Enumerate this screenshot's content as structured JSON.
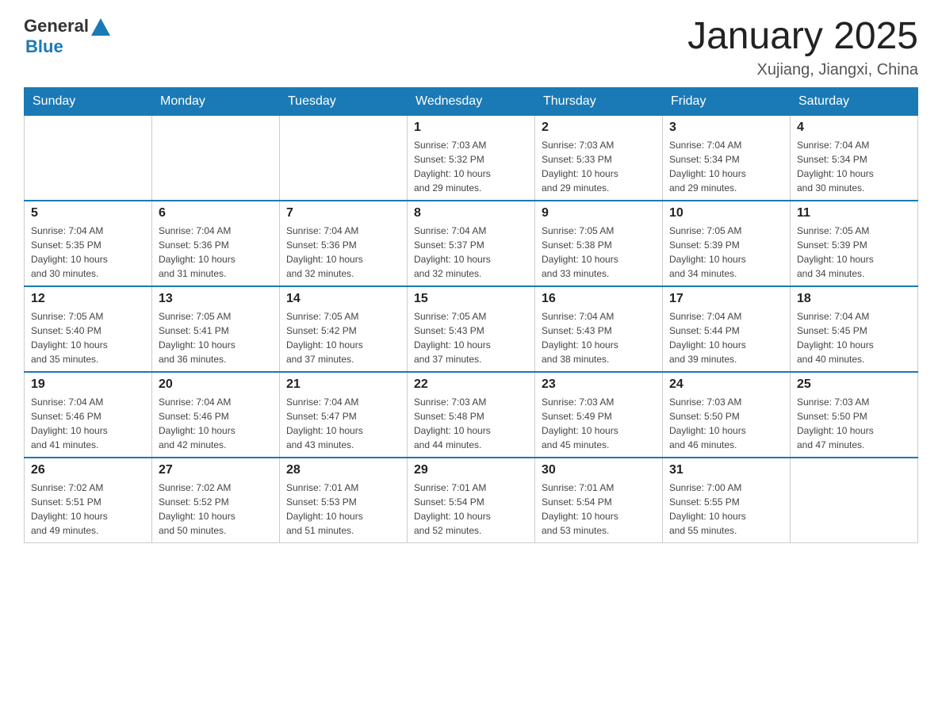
{
  "logo": {
    "general": "General",
    "blue": "Blue"
  },
  "title": "January 2025",
  "subtitle": "Xujiang, Jiangxi, China",
  "days": [
    "Sunday",
    "Monday",
    "Tuesday",
    "Wednesday",
    "Thursday",
    "Friday",
    "Saturday"
  ],
  "weeks": [
    [
      {
        "day": "",
        "info": ""
      },
      {
        "day": "",
        "info": ""
      },
      {
        "day": "",
        "info": ""
      },
      {
        "day": "1",
        "info": "Sunrise: 7:03 AM\nSunset: 5:32 PM\nDaylight: 10 hours\nand 29 minutes."
      },
      {
        "day": "2",
        "info": "Sunrise: 7:03 AM\nSunset: 5:33 PM\nDaylight: 10 hours\nand 29 minutes."
      },
      {
        "day": "3",
        "info": "Sunrise: 7:04 AM\nSunset: 5:34 PM\nDaylight: 10 hours\nand 29 minutes."
      },
      {
        "day": "4",
        "info": "Sunrise: 7:04 AM\nSunset: 5:34 PM\nDaylight: 10 hours\nand 30 minutes."
      }
    ],
    [
      {
        "day": "5",
        "info": "Sunrise: 7:04 AM\nSunset: 5:35 PM\nDaylight: 10 hours\nand 30 minutes."
      },
      {
        "day": "6",
        "info": "Sunrise: 7:04 AM\nSunset: 5:36 PM\nDaylight: 10 hours\nand 31 minutes."
      },
      {
        "day": "7",
        "info": "Sunrise: 7:04 AM\nSunset: 5:36 PM\nDaylight: 10 hours\nand 32 minutes."
      },
      {
        "day": "8",
        "info": "Sunrise: 7:04 AM\nSunset: 5:37 PM\nDaylight: 10 hours\nand 32 minutes."
      },
      {
        "day": "9",
        "info": "Sunrise: 7:05 AM\nSunset: 5:38 PM\nDaylight: 10 hours\nand 33 minutes."
      },
      {
        "day": "10",
        "info": "Sunrise: 7:05 AM\nSunset: 5:39 PM\nDaylight: 10 hours\nand 34 minutes."
      },
      {
        "day": "11",
        "info": "Sunrise: 7:05 AM\nSunset: 5:39 PM\nDaylight: 10 hours\nand 34 minutes."
      }
    ],
    [
      {
        "day": "12",
        "info": "Sunrise: 7:05 AM\nSunset: 5:40 PM\nDaylight: 10 hours\nand 35 minutes."
      },
      {
        "day": "13",
        "info": "Sunrise: 7:05 AM\nSunset: 5:41 PM\nDaylight: 10 hours\nand 36 minutes."
      },
      {
        "day": "14",
        "info": "Sunrise: 7:05 AM\nSunset: 5:42 PM\nDaylight: 10 hours\nand 37 minutes."
      },
      {
        "day": "15",
        "info": "Sunrise: 7:05 AM\nSunset: 5:43 PM\nDaylight: 10 hours\nand 37 minutes."
      },
      {
        "day": "16",
        "info": "Sunrise: 7:04 AM\nSunset: 5:43 PM\nDaylight: 10 hours\nand 38 minutes."
      },
      {
        "day": "17",
        "info": "Sunrise: 7:04 AM\nSunset: 5:44 PM\nDaylight: 10 hours\nand 39 minutes."
      },
      {
        "day": "18",
        "info": "Sunrise: 7:04 AM\nSunset: 5:45 PM\nDaylight: 10 hours\nand 40 minutes."
      }
    ],
    [
      {
        "day": "19",
        "info": "Sunrise: 7:04 AM\nSunset: 5:46 PM\nDaylight: 10 hours\nand 41 minutes."
      },
      {
        "day": "20",
        "info": "Sunrise: 7:04 AM\nSunset: 5:46 PM\nDaylight: 10 hours\nand 42 minutes."
      },
      {
        "day": "21",
        "info": "Sunrise: 7:04 AM\nSunset: 5:47 PM\nDaylight: 10 hours\nand 43 minutes."
      },
      {
        "day": "22",
        "info": "Sunrise: 7:03 AM\nSunset: 5:48 PM\nDaylight: 10 hours\nand 44 minutes."
      },
      {
        "day": "23",
        "info": "Sunrise: 7:03 AM\nSunset: 5:49 PM\nDaylight: 10 hours\nand 45 minutes."
      },
      {
        "day": "24",
        "info": "Sunrise: 7:03 AM\nSunset: 5:50 PM\nDaylight: 10 hours\nand 46 minutes."
      },
      {
        "day": "25",
        "info": "Sunrise: 7:03 AM\nSunset: 5:50 PM\nDaylight: 10 hours\nand 47 minutes."
      }
    ],
    [
      {
        "day": "26",
        "info": "Sunrise: 7:02 AM\nSunset: 5:51 PM\nDaylight: 10 hours\nand 49 minutes."
      },
      {
        "day": "27",
        "info": "Sunrise: 7:02 AM\nSunset: 5:52 PM\nDaylight: 10 hours\nand 50 minutes."
      },
      {
        "day": "28",
        "info": "Sunrise: 7:01 AM\nSunset: 5:53 PM\nDaylight: 10 hours\nand 51 minutes."
      },
      {
        "day": "29",
        "info": "Sunrise: 7:01 AM\nSunset: 5:54 PM\nDaylight: 10 hours\nand 52 minutes."
      },
      {
        "day": "30",
        "info": "Sunrise: 7:01 AM\nSunset: 5:54 PM\nDaylight: 10 hours\nand 53 minutes."
      },
      {
        "day": "31",
        "info": "Sunrise: 7:00 AM\nSunset: 5:55 PM\nDaylight: 10 hours\nand 55 minutes."
      },
      {
        "day": "",
        "info": ""
      }
    ]
  ]
}
